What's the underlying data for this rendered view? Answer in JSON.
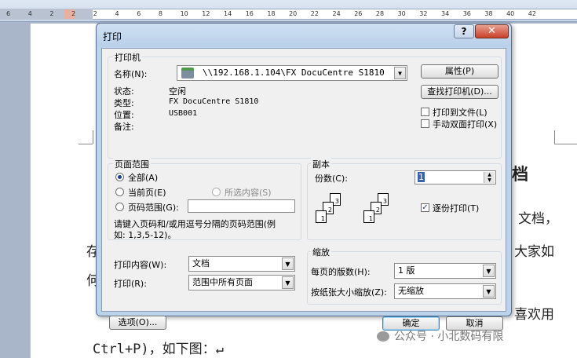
{
  "ruler": {
    "ticks": [
      "6",
      "4",
      "2",
      "2",
      "2",
      "4",
      "6",
      "8",
      "10",
      "12",
      "14",
      "16",
      "18",
      "20",
      "22",
      "24",
      "26",
      "28",
      "30",
      "32",
      "34",
      "36",
      "38",
      "40",
      "42"
    ]
  },
  "doc": {
    "heading_fragment": "档",
    "line1_end": "文档，",
    "line2_start": "存",
    "line2_end": "大家如",
    "line3_start": "何",
    "line4_text": "喜欢用",
    "line5_text": "Ctrl+P)，如下图：↵",
    "watermark": "公众号 · 小北数码有限"
  },
  "dialog": {
    "title": "打印",
    "help_glyph": "?",
    "close_glyph": "✕",
    "printer": {
      "group": "打印机",
      "name_label": "名称(N):",
      "name_value": "\\\\192.168.1.104\\FX DocuCentre S1810",
      "status_label": "状态:",
      "status_value": "空闲",
      "type_label": "类型:",
      "type_value": "FX DocuCentre S1810",
      "where_label": "位置:",
      "where_value": "USB001",
      "comment_label": "备注:",
      "properties": "属性(P)",
      "find_printer": "查找打印机(D)...",
      "print_to_file": "打印到文件(L)",
      "manual_duplex": "手动双面打印(X)"
    },
    "range": {
      "group": "页面范围",
      "all": "全部(A)",
      "current": "当前页(E)",
      "selection": "所选内容(S)",
      "pages": "页码范围(G):",
      "hint1": "请键入页码和/或用逗号分隔的页码范围(例",
      "hint2": "如: 1,3,5-12)。"
    },
    "copies": {
      "group": "副本",
      "count_label": "份数(C):",
      "count_value": "1",
      "collate": "逐份打印(T)",
      "stack_a": [
        "1",
        "2",
        "3"
      ],
      "stack_b": [
        "1",
        "2",
        "3"
      ]
    },
    "print_what_label": "打印内容(W):",
    "print_what_value": "文档",
    "print_label": "打印(R):",
    "print_value": "范围中所有页面",
    "zoom": {
      "group": "缩放",
      "pages_per_sheet_label": "每页的版数(H):",
      "pages_per_sheet_value": "1 版",
      "scale_label": "按纸张大小缩放(Z):",
      "scale_value": "无缩放"
    },
    "options": "选项(O)...",
    "ok": "确定",
    "cancel": "取消"
  }
}
